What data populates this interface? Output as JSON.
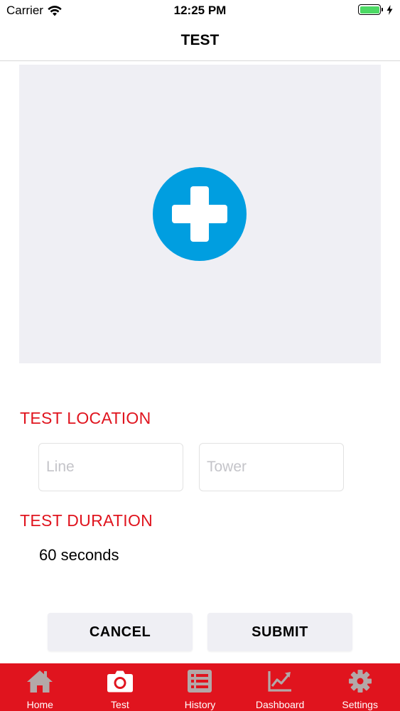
{
  "status_bar": {
    "carrier": "Carrier",
    "time": "12:25 PM",
    "battery_level": 1.0,
    "icons": [
      "wifi-icon",
      "battery-icon",
      "charging-bolt-icon"
    ]
  },
  "nav": {
    "title": "TEST"
  },
  "image_picker": {
    "icon": "plus-icon",
    "accent_color": "#009ee0",
    "background_color": "#efeff4"
  },
  "location": {
    "header": "TEST LOCATION",
    "line_placeholder": "Line",
    "line_value": "",
    "tower_placeholder": "Tower",
    "tower_value": ""
  },
  "duration": {
    "header": "TEST DURATION",
    "value": "60 seconds"
  },
  "buttons": {
    "cancel_label": "CANCEL",
    "submit_label": "SUBMIT"
  },
  "tab_bar": {
    "background_color": "#e0141e",
    "active_icon_color": "#ffffff",
    "inactive_icon_color": "#b3a8a8",
    "tabs": [
      {
        "label": "Home",
        "icon": "home-icon",
        "active": false
      },
      {
        "label": "Test",
        "icon": "camera-icon",
        "active": true
      },
      {
        "label": "History",
        "icon": "list-icon",
        "active": false
      },
      {
        "label": "Dashboard",
        "icon": "chart-icon",
        "active": false
      },
      {
        "label": "Settings",
        "icon": "gear-icon",
        "active": false
      }
    ]
  },
  "colors": {
    "section_header": "#e0141e",
    "button_background": "#efeff4"
  }
}
